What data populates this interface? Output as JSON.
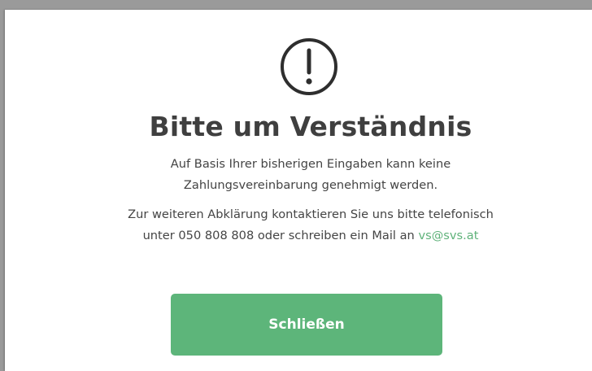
{
  "dialog": {
    "icon": "exclamation-circle-icon",
    "title": "Bitte um Verständnis",
    "message_line_1": "Auf Basis Ihrer bisherigen Eingaben kann keine",
    "message_line_2": "Zahlungsvereinbarung genehmigt werden.",
    "contact_line_1": "Zur weiteren Abklärung kontaktieren Sie uns bitte telefonisch",
    "contact_line_2_prefix": "unter 050 808 808 oder schreiben ein Mail an ",
    "email": "vs@svs.at",
    "close_label": "Schließen"
  },
  "colors": {
    "accent": "#5db57a",
    "link": "#5fb27a",
    "title": "#3f3f3f",
    "text": "#444444"
  }
}
